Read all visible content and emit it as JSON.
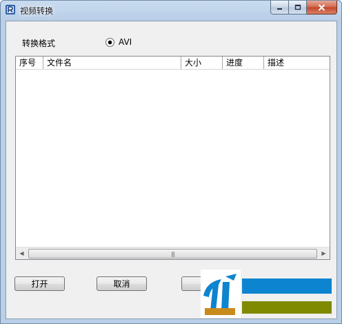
{
  "window": {
    "title": "视频转换",
    "controls": [
      "minimize",
      "maximize",
      "close"
    ]
  },
  "format": {
    "label": "转换格式",
    "option_label": "AVI",
    "selected": true
  },
  "table": {
    "columns": [
      "序号",
      "文件名",
      "大小",
      "进度",
      "描述"
    ],
    "rows": []
  },
  "buttons": {
    "open": "打开",
    "cancel": "取消"
  },
  "colors": {
    "titlebar": "#b9cfe8",
    "client_bg": "#f0f0f0",
    "close_button": "#c2452a",
    "logo_blue": "#0d84cf",
    "logo_olive": "#7f8a00"
  }
}
